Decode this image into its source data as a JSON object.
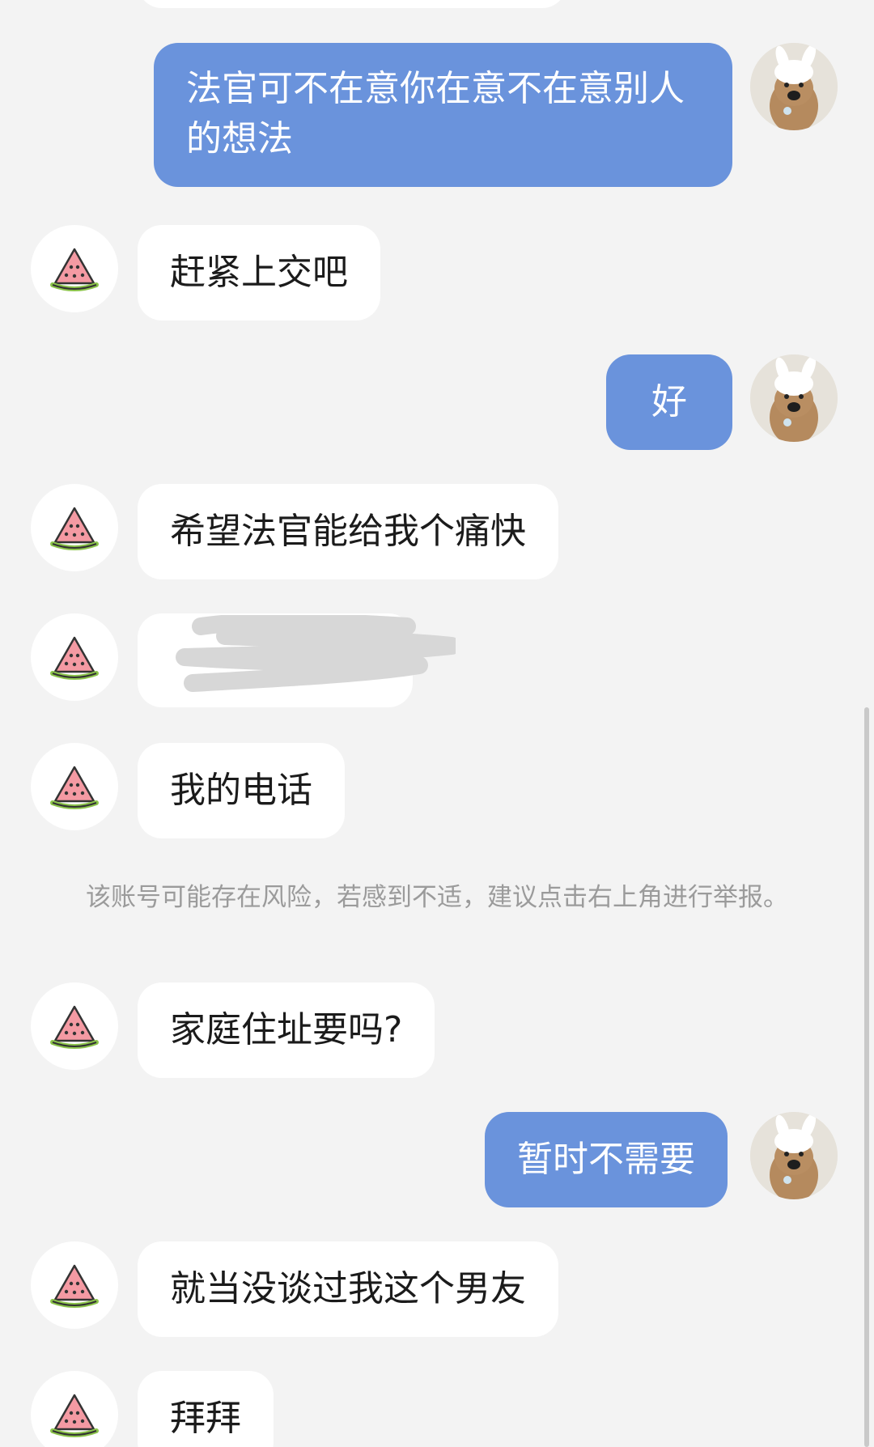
{
  "messages": [
    {
      "text": "法官可不在意你在意不在意别人的想法"
    },
    {
      "text": "赶紧上交吧"
    },
    {
      "text": "好"
    },
    {
      "text": "希望法官能给我个痛快"
    },
    {
      "text": "我的电话"
    },
    {
      "text": "家庭住址要吗?"
    },
    {
      "text": "暂时不需要"
    },
    {
      "text": "就当没谈过我这个男友"
    },
    {
      "text": "拜拜"
    }
  ],
  "risk_notice": "该账号可能存在风险，若感到不适，建议点击右上角进行举报。",
  "avatars": {
    "other": "watermelon-icon",
    "self": "plush-dog-photo"
  },
  "colors": {
    "background": "#f3f3f3",
    "self_bubble": "#6a93dc",
    "other_bubble": "#ffffff",
    "notice_text": "#9b9b9b"
  }
}
